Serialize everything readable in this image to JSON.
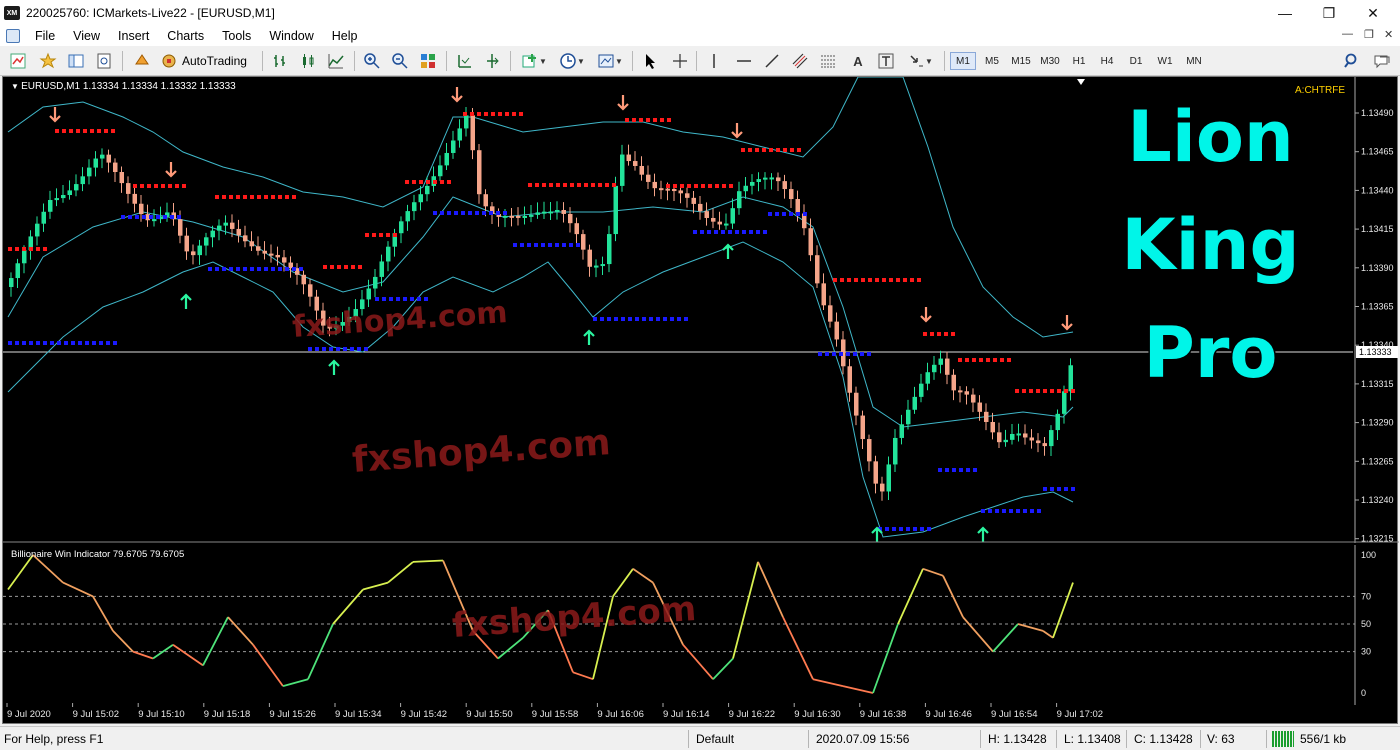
{
  "window": {
    "title": "220025760: ICMarkets-Live22 - [EURUSD,M1]",
    "logo_text": "XM",
    "minimize": "—",
    "maximize": "❐",
    "close": "✕"
  },
  "menu": {
    "items": [
      "File",
      "View",
      "Insert",
      "Charts",
      "Tools",
      "Window",
      "Help"
    ]
  },
  "toolbar": {
    "autotrading_label": "AutoTrading",
    "timeframes": [
      "M1",
      "M5",
      "M15",
      "M30",
      "H1",
      "H4",
      "D1",
      "W1",
      "MN"
    ],
    "active_timeframe": "M1"
  },
  "chart": {
    "header": "EURUSD,M1  1.13334 1.13334 1.13332 1.13333",
    "account_tag": "A:CHTRFE",
    "brand_lines": [
      "Lion",
      "King",
      "Pro"
    ],
    "watermark": "fxshop4.com",
    "current_price": "1.13333",
    "price_ticks": [
      "1.13490",
      "1.13465",
      "1.13440",
      "1.13415",
      "1.13390",
      "1.13365",
      "1.13340",
      "1.13315",
      "1.13290",
      "1.13265",
      "1.13240",
      "1.13215"
    ],
    "indicator_header": "Billionaire Win Indicator 79.6705 79.6705",
    "indicator_levels": [
      "100",
      "70",
      "50",
      "30",
      "0"
    ],
    "time_ticks": [
      "9 Jul 2020",
      "9 Jul 15:02",
      "9 Jul 15:10",
      "9 Jul 15:18",
      "9 Jul 15:26",
      "9 Jul 15:34",
      "9 Jul 15:42",
      "9 Jul 15:50",
      "9 Jul 15:58",
      "9 Jul 16:06",
      "9 Jul 16:14",
      "9 Jul 16:22",
      "9 Jul 16:30",
      "9 Jul 16:38",
      "9 Jul 16:46",
      "9 Jul 16:54",
      "9 Jul 17:02"
    ],
    "colors": {
      "bull": "#22e39a",
      "bear": "#f5a58a",
      "band": "#3fb7c9",
      "resistance": "#ff1a1a",
      "support": "#1a1aff",
      "arrow_up": "#2af5a0",
      "arrow_down": "#ff9a7a",
      "watermark": "#8b1a1a"
    }
  },
  "status": {
    "help": "For Help, press F1",
    "profile": "Default",
    "datetime": "2020.07.09 15:56",
    "high": "H: 1.13428",
    "low": "L: 1.13408",
    "close": "C: 1.13428",
    "volume": "V: 63",
    "traffic": "556/1 kb"
  }
}
